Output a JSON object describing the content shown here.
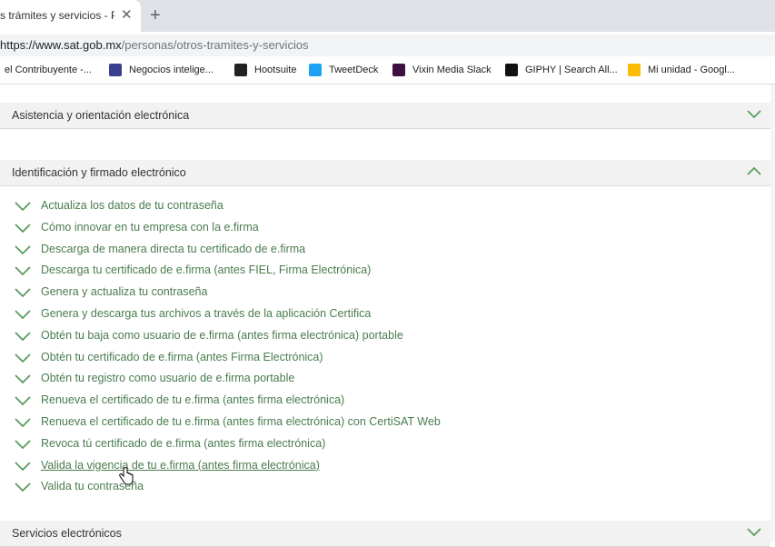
{
  "tab": {
    "title": "s trámites y servicios - Po",
    "close": "✕",
    "new_tab": "+"
  },
  "address": {
    "host": "https://www.sat.gob.mx",
    "path": "/personas/otros-tramites-y-servicios"
  },
  "bookmarks": [
    {
      "label": "el Contribuyente -...",
      "icon": "",
      "color": ""
    },
    {
      "label": "Negocios intelige...",
      "icon": "negocios-icon",
      "color": "#3b3f8f"
    },
    {
      "label": "Hootsuite",
      "icon": "hootsuite-icon",
      "color": "#222222"
    },
    {
      "label": "TweetDeck",
      "icon": "tweetdeck-icon",
      "color": "#1da1f2"
    },
    {
      "label": "Vixin Media Slack",
      "icon": "slack-icon",
      "color": "#3f0f3f"
    },
    {
      "label": "GIPHY | Search All...",
      "icon": "giphy-icon",
      "color": "#111111"
    },
    {
      "label": "Mi unidad - Googl...",
      "icon": "drive-icon",
      "color": "#fbbc04"
    }
  ],
  "sections": {
    "asistencia": {
      "title": "Asistencia y orientación electrónica",
      "expanded": false
    },
    "identificacion": {
      "title": "Identificación y firmado electrónico",
      "expanded": true
    },
    "servicios": {
      "title": "Servicios electrónicos",
      "expanded": false
    }
  },
  "links": [
    "Actualiza los datos de tu contraseña",
    "Cómo innovar en tu empresa con la e.firma",
    "Descarga de manera directa tu certificado de e.firma",
    "Descarga tu certificado de e.firma (antes FIEL, Firma Electrónica)",
    "Genera y actualiza tu contraseña",
    "Genera y descarga tus archivos a través de la aplicación Certifica",
    "Obtén tu baja como usuario de e.firma (antes firma electrónica) portable",
    "Obtén tu certificado de e.firma (antes Firma Electrónica)",
    "Obtén tu registro como usuario de e.firma portable",
    "Renueva el certificado de tu e.firma (antes firma electrónica)",
    "Renueva el certificado de tu e.firma (antes firma electrónica) con CertiSAT Web",
    "Revoca tú certificado de e.firma (antes firma electrónica)",
    "Valida la vigencia de tu e.firma (antes firma electrónica)",
    "Valida tu contraseña"
  ],
  "hovered_link_index": 12,
  "colors": {
    "accent": "#4a7c4f",
    "chevron": "#5a9c5e"
  }
}
